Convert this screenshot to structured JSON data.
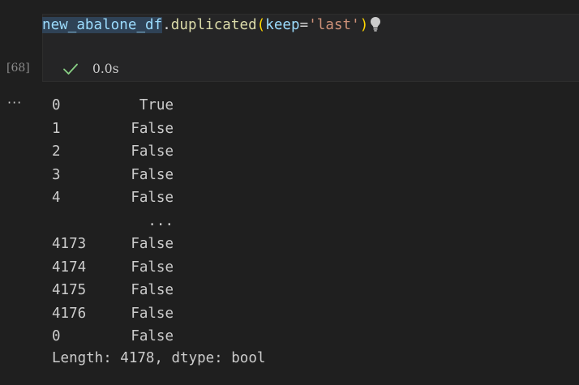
{
  "cell": {
    "execution_count": "[68]",
    "code": {
      "variable": "new_abalone_df",
      "dot": ".",
      "method": "duplicated",
      "open_paren": "(",
      "param": "keep",
      "equals": "=",
      "string": "'last'",
      "close_paren": ")"
    },
    "status": {
      "icon": "check-icon",
      "time": "0.0s"
    }
  },
  "output": {
    "more_actions": "···",
    "rows": [
      {
        "index": "0",
        "value": "True"
      },
      {
        "index": "1",
        "value": "False"
      },
      {
        "index": "2",
        "value": "False"
      },
      {
        "index": "3",
        "value": "False"
      },
      {
        "index": "4",
        "value": "False"
      },
      {
        "index": "",
        "value": "..."
      },
      {
        "index": "4173",
        "value": "False"
      },
      {
        "index": "4174",
        "value": "False"
      },
      {
        "index": "4175",
        "value": "False"
      },
      {
        "index": "4176",
        "value": "False"
      },
      {
        "index": "0",
        "value": "False"
      }
    ],
    "footer": "Length: 4178, dtype: bool"
  },
  "colors": {
    "background": "#1f1f1f",
    "cell_background": "#252526",
    "variable": "#9cdcfe",
    "function": "#dcdcaa",
    "paren": "#ffd700",
    "string": "#ce9178",
    "success": "#89d185"
  }
}
